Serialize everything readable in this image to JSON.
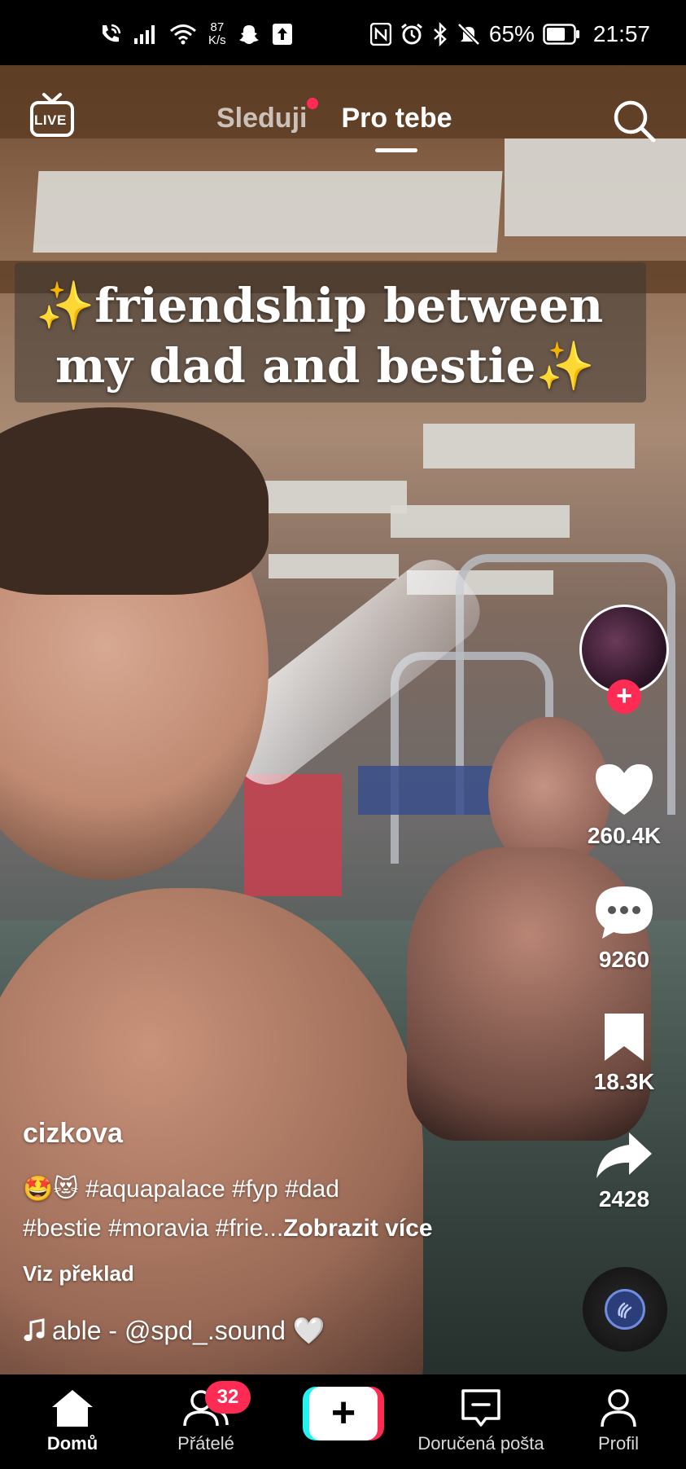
{
  "status_bar": {
    "net_speed_value": "87",
    "net_speed_unit": "K/s",
    "battery_percent": "65%",
    "time": "21:57",
    "icons_left": [
      "wifi-call-icon",
      "cell-signal-icon",
      "wifi-icon",
      "snapchat-icon",
      "upload-icon"
    ],
    "icons_right": [
      "nfc-icon",
      "alarm-icon",
      "bluetooth-icon",
      "mute-icon",
      "battery-icon"
    ]
  },
  "top_nav": {
    "live_label": "LIVE",
    "tabs": [
      {
        "label": "Sleduji",
        "active": false,
        "has_dot": true
      },
      {
        "label": "Pro tebe",
        "active": true
      }
    ]
  },
  "video": {
    "overlay_caption_line1": "✨friendship between",
    "overlay_caption_line2": "my dad and bestie✨"
  },
  "actions": {
    "likes": "260.4K",
    "comments": "9260",
    "saves": "18.3K",
    "shares": "2428"
  },
  "post": {
    "username": "cizkova",
    "emoji": "🤩😻",
    "description_line1": "#aquapalace #fyp #dad",
    "description_line2": "#bestie #moravia #frie...",
    "see_more": "Zobrazit více",
    "translate": "Viz překlad",
    "sound": "able - @spd_.sound 🤍"
  },
  "bottom_nav": {
    "items": [
      {
        "label": "Domů",
        "active": true
      },
      {
        "label": "Přátelé",
        "badge": "32"
      },
      {
        "label": "Doručená pošta"
      },
      {
        "label": "Profil"
      }
    ]
  },
  "colors": {
    "accent": "#fe2c55",
    "cyan": "#25f4ee",
    "background": "#000000"
  }
}
